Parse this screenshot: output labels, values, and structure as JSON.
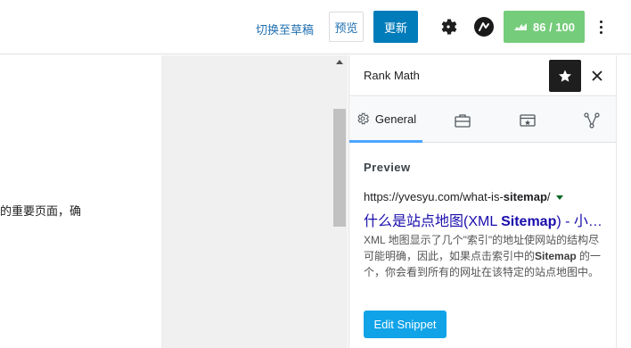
{
  "toolbar": {
    "switch_to_draft": "切换至草稿",
    "preview": "预览",
    "update": "更新",
    "score": "86 / 100",
    "settings_icon": "gear-icon",
    "rankmath_icon": "rank-math-logo-icon",
    "more_icon": "vertical-ellipsis-icon"
  },
  "editor": {
    "text_fragment": "的重要页面，确"
  },
  "panel": {
    "title": "Rank Math",
    "tabs": [
      {
        "label": "General",
        "icon": "gear-icon",
        "active": true
      },
      {
        "label": "",
        "icon": "briefcase-icon"
      },
      {
        "label": "",
        "icon": "schema-icon"
      },
      {
        "label": "",
        "icon": "share-icon"
      }
    ],
    "preview": {
      "heading": "Preview",
      "url_prefix": "https://yvesyu.com/what-is-",
      "url_keyword": "sitemap",
      "url_suffix": "/",
      "title_prefix": "什么是站点地图(XML ",
      "title_keyword": "Sitemap",
      "title_suffix": ") - 小…",
      "desc_part1": "XML 地图显示了几个\"索引\"的地址使网站的结构尽可能明确，因此，如果点击索引中的",
      "desc_keyword": "Sitemap",
      "desc_part2": " 的一个，你会看到所有的网址在该特定的站点地图中。",
      "edit_button": "Edit Snippet"
    }
  },
  "colors": {
    "update_button": "#007cba",
    "score_badge": "#75cc7b",
    "serp_title": "#1a0dab",
    "edit_button": "#10a3e8",
    "tab_active": "#4ca5ff"
  }
}
